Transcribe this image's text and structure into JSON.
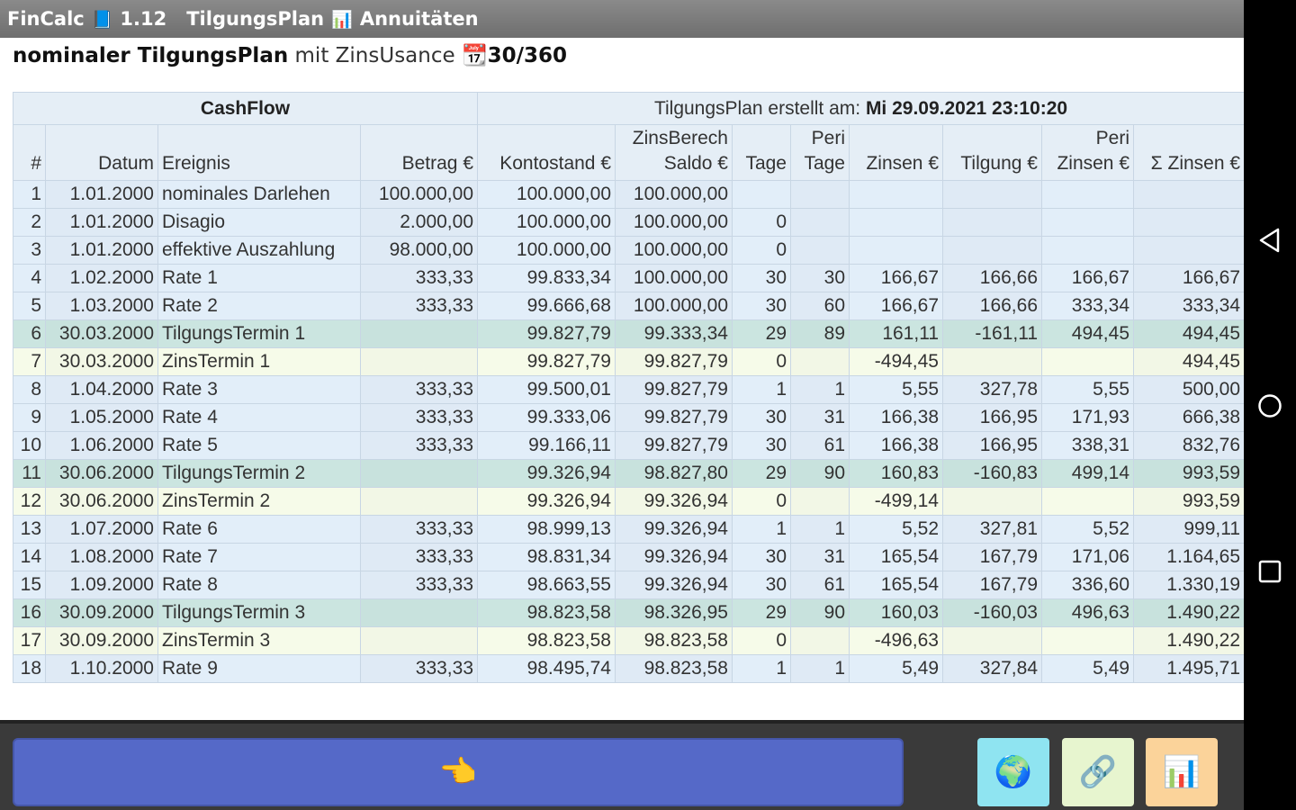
{
  "titlebar": {
    "app": "FinCalc",
    "app_icon": "📘",
    "version": "1.12",
    "plan": "TilgungsPlan",
    "plan_icon": "📊",
    "mode": "Annuitäten"
  },
  "heading": {
    "bold": "nominaler TilgungsPlan",
    "mid": "mit ZinsUsance",
    "icon": "📆",
    "usance": "30/360"
  },
  "table": {
    "group_cashflow": "CashFlow",
    "group_created_label": "TilgungsPlan erstellt am:",
    "group_created_value": "Mi 29.09.2021 23:10:20",
    "headers": [
      "#",
      "Datum",
      "Ereignis",
      "Betrag €",
      "Kontostand €",
      "ZinsBerech Saldo €",
      "Tage",
      "Peri Tage",
      "Zinsen €",
      "Tilgung €",
      "Peri Zinsen €",
      "Σ Zinsen €"
    ],
    "rows": [
      {
        "type": "rate",
        "cells": [
          "1",
          "1.01.2000",
          "nominales Darlehen",
          "100.000,00",
          "100.000,00",
          "100.000,00",
          "",
          "",
          "",
          "",
          "",
          ""
        ]
      },
      {
        "type": "rate",
        "cells": [
          "2",
          "1.01.2000",
          "Disagio",
          "2.000,00",
          "100.000,00",
          "100.000,00",
          "0",
          "",
          "",
          "",
          "",
          ""
        ]
      },
      {
        "type": "rate",
        "cells": [
          "3",
          "1.01.2000",
          "effektive Auszahlung",
          "98.000,00",
          "100.000,00",
          "100.000,00",
          "0",
          "",
          "",
          "",
          "",
          ""
        ]
      },
      {
        "type": "rate",
        "cells": [
          "4",
          "1.02.2000",
          "Rate 1",
          "333,33",
          "99.833,34",
          "100.000,00",
          "30",
          "30",
          "166,67",
          "166,66",
          "166,67",
          "166,67"
        ]
      },
      {
        "type": "rate",
        "cells": [
          "5",
          "1.03.2000",
          "Rate 2",
          "333,33",
          "99.666,68",
          "100.000,00",
          "30",
          "60",
          "166,67",
          "166,66",
          "333,34",
          "333,34"
        ]
      },
      {
        "type": "tilg",
        "cells": [
          "6",
          "30.03.2000",
          "TilgungsTermin 1",
          "",
          "99.827,79",
          "99.333,34",
          "29",
          "89",
          "161,11",
          "-161,11",
          "494,45",
          "494,45"
        ]
      },
      {
        "type": "zins",
        "cells": [
          "7",
          "30.03.2000",
          "ZinsTermin 1",
          "",
          "99.827,79",
          "99.827,79",
          "0",
          "",
          "-494,45",
          "",
          "",
          "494,45"
        ]
      },
      {
        "type": "rate",
        "cells": [
          "8",
          "1.04.2000",
          "Rate 3",
          "333,33",
          "99.500,01",
          "99.827,79",
          "1",
          "1",
          "5,55",
          "327,78",
          "5,55",
          "500,00"
        ]
      },
      {
        "type": "rate",
        "cells": [
          "9",
          "1.05.2000",
          "Rate 4",
          "333,33",
          "99.333,06",
          "99.827,79",
          "30",
          "31",
          "166,38",
          "166,95",
          "171,93",
          "666,38"
        ]
      },
      {
        "type": "rate",
        "cells": [
          "10",
          "1.06.2000",
          "Rate 5",
          "333,33",
          "99.166,11",
          "99.827,79",
          "30",
          "61",
          "166,38",
          "166,95",
          "338,31",
          "832,76"
        ]
      },
      {
        "type": "tilg",
        "cells": [
          "11",
          "30.06.2000",
          "TilgungsTermin 2",
          "",
          "99.326,94",
          "98.827,80",
          "29",
          "90",
          "160,83",
          "-160,83",
          "499,14",
          "993,59"
        ]
      },
      {
        "type": "zins",
        "cells": [
          "12",
          "30.06.2000",
          "ZinsTermin 2",
          "",
          "99.326,94",
          "99.326,94",
          "0",
          "",
          "-499,14",
          "",
          "",
          "993,59"
        ]
      },
      {
        "type": "rate",
        "cells": [
          "13",
          "1.07.2000",
          "Rate 6",
          "333,33",
          "98.999,13",
          "99.326,94",
          "1",
          "1",
          "5,52",
          "327,81",
          "5,52",
          "999,11"
        ]
      },
      {
        "type": "rate",
        "cells": [
          "14",
          "1.08.2000",
          "Rate 7",
          "333,33",
          "98.831,34",
          "99.326,94",
          "30",
          "31",
          "165,54",
          "167,79",
          "171,06",
          "1.164,65"
        ]
      },
      {
        "type": "rate",
        "cells": [
          "15",
          "1.09.2000",
          "Rate 8",
          "333,33",
          "98.663,55",
          "99.326,94",
          "30",
          "61",
          "165,54",
          "167,79",
          "336,60",
          "1.330,19"
        ]
      },
      {
        "type": "tilg",
        "cells": [
          "16",
          "30.09.2000",
          "TilgungsTermin 3",
          "",
          "98.823,58",
          "98.326,95",
          "29",
          "90",
          "160,03",
          "-160,03",
          "496,63",
          "1.490,22"
        ]
      },
      {
        "type": "zins",
        "cells": [
          "17",
          "30.09.2000",
          "ZinsTermin 3",
          "",
          "98.823,58",
          "98.823,58",
          "0",
          "",
          "-496,63",
          "",
          "",
          "1.490,22"
        ]
      },
      {
        "type": "rate",
        "cells": [
          "18",
          "1.10.2000",
          "Rate 9",
          "333,33",
          "98.495,74",
          "98.823,58",
          "1",
          "1",
          "5,49",
          "327,84",
          "5,49",
          "1.495,71"
        ]
      }
    ]
  },
  "bottom": {
    "main_icon": "👈",
    "globe_icon": "🌍",
    "link_icon": "🔗",
    "chart_icon": "📊"
  },
  "icons": {
    "back": "back-triangle-icon",
    "home": "home-circle-icon",
    "recents": "recents-square-icon"
  }
}
